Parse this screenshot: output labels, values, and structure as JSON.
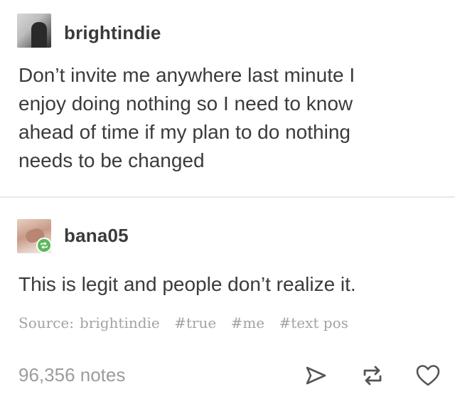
{
  "original_post": {
    "username": "brightindie",
    "body_lines": [
      "Don’t invite me anywhere last minute I",
      "enjoy doing nothing so I need to know",
      "ahead of time if my plan to do nothing",
      "needs to be changed"
    ]
  },
  "reblog": {
    "username": "bana05",
    "body": "This is legit and people don’t realize it.",
    "source_label": "Source:",
    "source_name": "brightindie",
    "tags": [
      "#true",
      "#me",
      "#text pos"
    ]
  },
  "footer": {
    "notes": "96,356 notes",
    "icons": [
      "share-icon",
      "reblog-icon",
      "heart-icon"
    ]
  },
  "colors": {
    "text": "#3b3b3b",
    "muted": "#9c9c9c",
    "reblog_badge": "#5cb85c",
    "divider": "#e9e9e9"
  }
}
